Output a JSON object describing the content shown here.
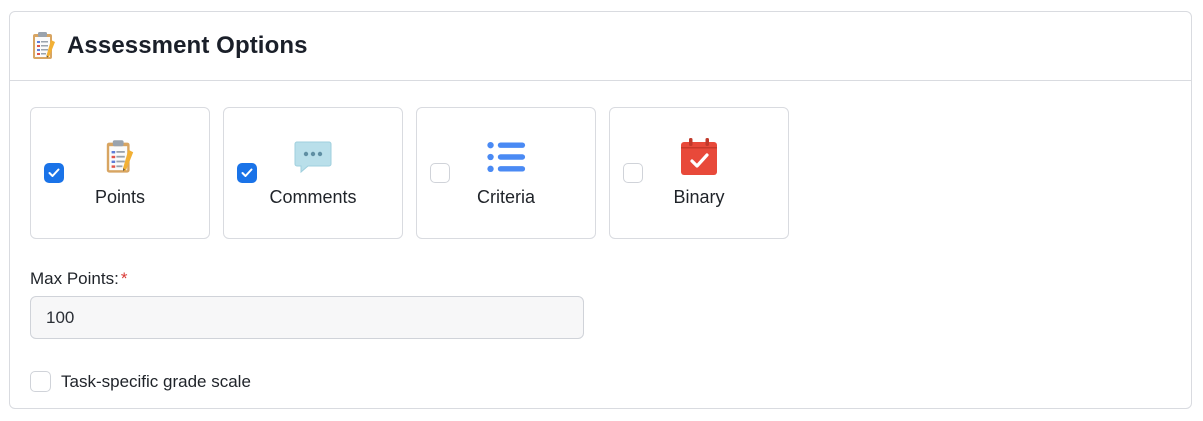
{
  "panel": {
    "title": "Assessment Options",
    "icon": "clipboard-memo-icon"
  },
  "options": [
    {
      "label": "Points",
      "checked": true,
      "icon": "clipboard-memo-icon"
    },
    {
      "label": "Comments",
      "checked": true,
      "icon": "speech-bubble-icon"
    },
    {
      "label": "Criteria",
      "checked": false,
      "icon": "bullet-list-icon"
    },
    {
      "label": "Binary",
      "checked": false,
      "icon": "calendar-check-icon"
    }
  ],
  "max_points": {
    "label": "Max Points:",
    "required_mark": "*",
    "value": "100"
  },
  "grade_scale": {
    "label": "Task-specific grade scale",
    "checked": false
  },
  "colors": {
    "accent": "#1a73e8",
    "required": "#d93a36",
    "border": "#d9dbe0",
    "list_icon": "#4a8af4",
    "calendar_icon": "#e8493a"
  }
}
